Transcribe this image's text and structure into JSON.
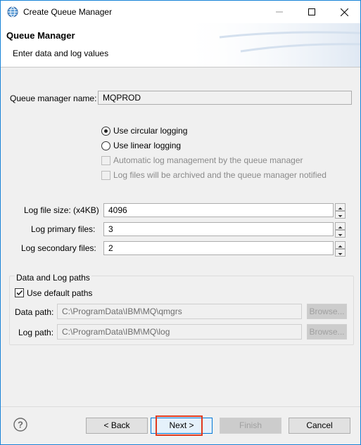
{
  "window": {
    "title": "Create Queue Manager"
  },
  "banner": {
    "heading": "Queue Manager",
    "subtitle": "Enter data and log values"
  },
  "qm": {
    "label": "Queue manager name:",
    "value": "MQPROD"
  },
  "logging": {
    "circular_label": "Use circular logging",
    "linear_label": "Use linear logging",
    "auto_label": "Automatic log management by the queue manager",
    "archive_label": "Log files will be archived and the queue manager notified"
  },
  "log_sizes": {
    "file_size_label": "Log file size: (x4KB)",
    "file_size_value": "4096",
    "primary_label": "Log primary files:",
    "primary_value": "3",
    "secondary_label": "Log secondary files:",
    "secondary_value": "2"
  },
  "paths": {
    "group_label": "Data and Log paths",
    "use_default_label": "Use default paths",
    "data_label": "Data path:",
    "data_value": "C:\\ProgramData\\IBM\\MQ\\qmgrs",
    "log_label": "Log path:",
    "log_value": "C:\\ProgramData\\IBM\\MQ\\log",
    "browse_label": "Browse..."
  },
  "footer": {
    "help": "?",
    "back": "< Back",
    "next": "Next >",
    "finish": "Finish",
    "cancel": "Cancel"
  }
}
